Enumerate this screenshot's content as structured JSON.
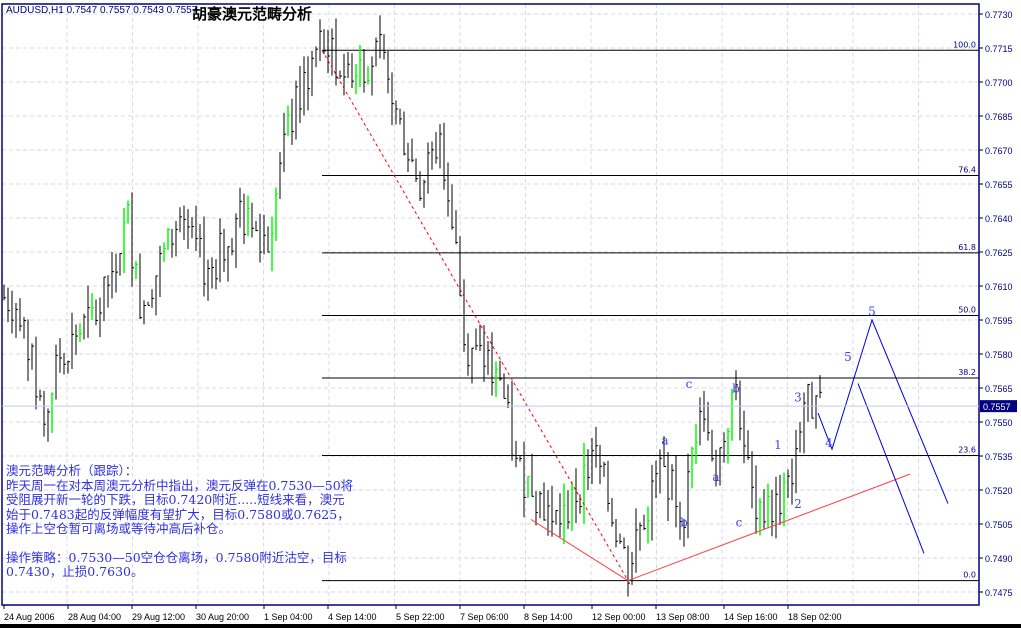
{
  "header": {
    "symbol": "AUDUSD,H1",
    "ohlc": "0.7547 0.7557 0.7543 0.7557",
    "title": "胡豪澳元范畴分析"
  },
  "note": {
    "heading": "澳元范畴分析（跟踪）：",
    "body": "昨天周一在对本周澳元分析中指出，澳元反弹在0.7530—50将受阻展开新一轮的下跌，目标0.7420附近.....短线来看，澳元始于0.7483起的反弹幅度有望扩大，目标0.7580或0.7625，操作上空仓暂可离场或等待冲高后补仓。",
    "strategy": "操作策略：0.7530—50空仓仓离场，0.7580附近沽空，目标0.7430，止损0.7630。"
  },
  "chart_data": {
    "type": "candlestick-bar",
    "symbol": "AUDUSD",
    "timeframe": "H1",
    "current_price": "0.7557",
    "ylim": [
      0.747,
      0.7736
    ],
    "y_ticks": [
      "0.7730",
      "0.7715",
      "0.7700",
      "0.7685",
      "0.7670",
      "0.7655",
      "0.7640",
      "0.7625",
      "0.7610",
      "0.7595",
      "0.7580",
      "0.7565",
      "0.7550",
      "0.7535",
      "0.7520",
      "0.7505",
      "0.7490",
      "0.7475"
    ],
    "x_ticks": [
      {
        "label": "24 Aug 2006",
        "bar": 0
      },
      {
        "label": "28 Aug 04:00",
        "bar": 16
      },
      {
        "label": "29 Aug 12:00",
        "bar": 32
      },
      {
        "label": "30 Aug 20:00",
        "bar": 48
      },
      {
        "label": "1 Sep 04:00",
        "bar": 65
      },
      {
        "label": "4 Sep 14:00",
        "bar": 81
      },
      {
        "label": "5 Sep 22:00",
        "bar": 98
      },
      {
        "label": "7 Sep 06:00",
        "bar": 114
      },
      {
        "label": "8 Sep 14:00",
        "bar": 130
      },
      {
        "label": "12 Sep 00:00",
        "bar": 147
      },
      {
        "label": "13 Sep 08:00",
        "bar": 163
      },
      {
        "label": "14 Sep 16:00",
        "bar": 180
      },
      {
        "label": "18 Sep 02:00",
        "bar": 196
      }
    ],
    "grid": true,
    "price_path": [
      [
        0,
        0.7605
      ],
      [
        4,
        0.76
      ],
      [
        10,
        0.755
      ],
      [
        14,
        0.758
      ],
      [
        24,
        0.76
      ],
      [
        31,
        0.764
      ],
      [
        34,
        0.76
      ],
      [
        44,
        0.764
      ],
      [
        51,
        0.7615
      ],
      [
        59,
        0.764
      ],
      [
        66,
        0.763
      ],
      [
        71,
        0.768
      ],
      [
        79,
        0.7718
      ],
      [
        85,
        0.7705
      ],
      [
        94,
        0.7712
      ],
      [
        99,
        0.768
      ],
      [
        104,
        0.7655
      ],
      [
        109,
        0.7675
      ],
      [
        113,
        0.763
      ],
      [
        115,
        0.7585
      ],
      [
        124,
        0.757
      ],
      [
        128,
        0.753
      ],
      [
        139,
        0.7505
      ],
      [
        148,
        0.7535
      ],
      [
        156,
        0.7485
      ],
      [
        164,
        0.753
      ],
      [
        170,
        0.751
      ],
      [
        174,
        0.756
      ],
      [
        178,
        0.753
      ],
      [
        183,
        0.7565
      ],
      [
        188,
        0.7505
      ],
      [
        196,
        0.752
      ],
      [
        200,
        0.756
      ],
      [
        204,
        0.7555
      ]
    ],
    "fibonacci": {
      "high": 0.7714,
      "low": 0.748,
      "levels": [
        {
          "label": "100.0",
          "ratio": 1.0
        },
        {
          "label": "76.4",
          "ratio": 0.764
        },
        {
          "label": "61.8",
          "ratio": 0.618
        },
        {
          "label": "50.0",
          "ratio": 0.5
        },
        {
          "label": "38.2",
          "ratio": 0.382
        },
        {
          "label": "23.6",
          "ratio": 0.236
        },
        {
          "label": "0.0",
          "ratio": 0.0
        }
      ]
    },
    "lines": [
      {
        "style": "dashed",
        "color": "#ff0000",
        "points": [
          [
            79.5,
            0.7714
          ],
          [
            156,
            0.748
          ]
        ]
      },
      {
        "style": "solid",
        "color": "#ff4040",
        "points": [
          [
            131.75,
            0.7507
          ],
          [
            156,
            0.748
          ],
          [
            226.5,
            0.7527
          ]
        ]
      },
      {
        "style": "solid",
        "color": "#0000dd",
        "points": [
          [
            203.5,
            0.7554
          ],
          [
            207,
            0.7538
          ],
          [
            217,
            0.7595
          ],
          [
            236,
            0.7514
          ]
        ]
      },
      {
        "style": "solid",
        "color": "#0000dd",
        "points": [
          [
            213.5,
            0.7567
          ],
          [
            230,
            0.7492
          ]
        ]
      }
    ],
    "wave_labels": [
      {
        "text": "c",
        "bar": 171.25,
        "price": 0.7565
      },
      {
        "text": "b",
        "bar": 183,
        "price": 0.7563
      },
      {
        "text": "a",
        "bar": 165.25,
        "price": 0.754
      },
      {
        "text": "a",
        "bar": 178,
        "price": 0.7524
      },
      {
        "text": "b",
        "bar": 170,
        "price": 0.7504
      },
      {
        "text": "c",
        "bar": 183.75,
        "price": 0.7504
      },
      {
        "text": "1",
        "bar": 193.5,
        "price": 0.7538
      },
      {
        "text": "2",
        "bar": 198.5,
        "price": 0.7512
      },
      {
        "text": "3",
        "bar": 198.5,
        "price": 0.7559
      },
      {
        "text": "4",
        "bar": 206.25,
        "price": 0.7539
      },
      {
        "text": "5",
        "bar": 211,
        "price": 0.7577
      },
      {
        "text": "5",
        "bar": 217,
        "price": 0.7597
      }
    ],
    "colors": {
      "frame": "#000080",
      "bars": "#000000",
      "up_bars": "#00ff00",
      "grid": "#d8d8f0",
      "wave_labels": "#4040ff",
      "price_tag_bg": "#000080"
    }
  }
}
